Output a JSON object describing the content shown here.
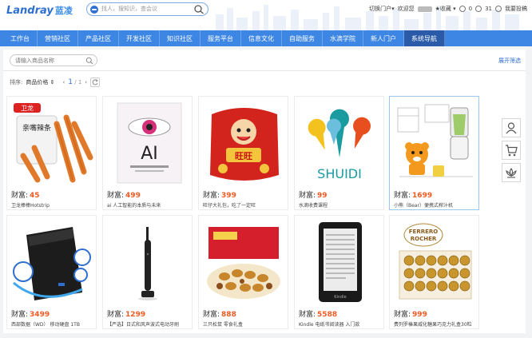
{
  "header": {
    "logo": "Landray",
    "logo_cn": "蓝凌",
    "search_placeholder": "找人，搜知识，查会议",
    "portal_switch": "切换门户▾",
    "welcome": "欢迎您",
    "favorites": "★收藏 ▾",
    "todo_count": "0",
    "msg_count": "31",
    "feedback": "我要投稿"
  },
  "nav": {
    "items": [
      "工作台",
      "营销社区",
      "产品社区",
      "开发社区",
      "知识社区",
      "服务平台",
      "信息文化",
      "自助服务",
      "水滴学院",
      "新人门户",
      "系统导航"
    ],
    "active_index": 10
  },
  "toolbar": {
    "search_placeholder": "请输入商品名称",
    "expand_filter": "展开筛选",
    "sort_label": "排序:",
    "sort_value": "商品价格 ⇕",
    "page_current": "1",
    "page_total": "/ 1"
  },
  "products": [
    {
      "price_label": "财富:",
      "price": "45",
      "name": "卫龙棒棒Hotstrip"
    },
    {
      "price_label": "财富:",
      "price": "499",
      "name": "ai 人工智能的本质与未来"
    },
    {
      "price_label": "财富:",
      "price": "399",
      "name": "旺仔大礼包，吃了一定旺"
    },
    {
      "price_label": "财富:",
      "price": "99",
      "name": "水滴收费课程"
    },
    {
      "price_label": "财富:",
      "price": "1699",
      "name": "小熊（Bear）便携式榨汁机"
    },
    {
      "price_label": "财富:",
      "price": "3499",
      "name": "西部数据（WD） 移动硬盘 1TB"
    },
    {
      "price_label": "财富:",
      "price": "1299",
      "name": "【严选】日式和风声波式电动牙刷"
    },
    {
      "price_label": "财富:",
      "price": "888",
      "name": "三只松鼠 零食礼盒"
    },
    {
      "price_label": "财富:",
      "price": "5588",
      "name": "Kindle 电纸书阅读器 入门款"
    },
    {
      "price_label": "财富:",
      "price": "999",
      "name": "费列罗榛果威化糖果巧克力礼盒30粒"
    }
  ],
  "product_images": {
    "p1": {
      "brand": "卫龙",
      "pack": "亲嘴辣条"
    },
    "p2": {
      "title": "AI"
    },
    "p3": {
      "text": "旺旺"
    },
    "p4": {
      "text": "SHUIDI"
    },
    "p9": {
      "text": "Kindle"
    },
    "p10": {
      "brand1": "FERRERO",
      "brand2": "ROCHER"
    }
  },
  "dock": [
    "user-icon",
    "cart-icon",
    "lotus-icon"
  ],
  "colors": {
    "nav_bg": "#3d86e3",
    "nav_active": "#2a5aa8",
    "price": "#f05a23",
    "link": "#2f6fd0"
  }
}
